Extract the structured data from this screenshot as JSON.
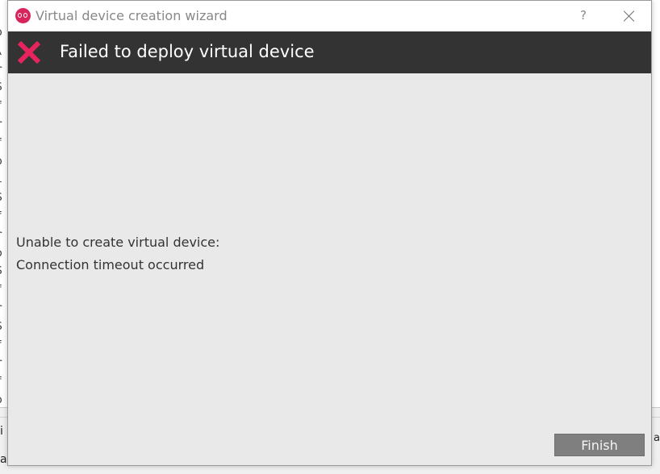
{
  "dialog": {
    "title": "Virtual device creation wizard",
    "help_label": "?",
    "banner_title": "Failed to deploy virtual device",
    "message_line1": "Unable to create virtual device:",
    "message_line2": "Connection timeout occurred",
    "finish_label": "Finish",
    "accent_color": "#e8245f",
    "banner_color": "#333333"
  },
  "background": {
    "console_fragments": [
      "o",
      "\\",
      "r",
      "S",
      "f",
      "r",
      "f",
      "o",
      "i",
      "S",
      "f",
      "r",
      "o",
      "S",
      "f",
      "r",
      "S",
      "f",
      "r",
      "f",
      "o"
    ],
    "bottom_left_1": "i",
    "bottom_left_2": "a",
    "bottom_right": "a"
  },
  "icons": {
    "app_icon": "app-logo-icon",
    "error_icon": "error-x-icon",
    "close_icon": "close-icon"
  }
}
